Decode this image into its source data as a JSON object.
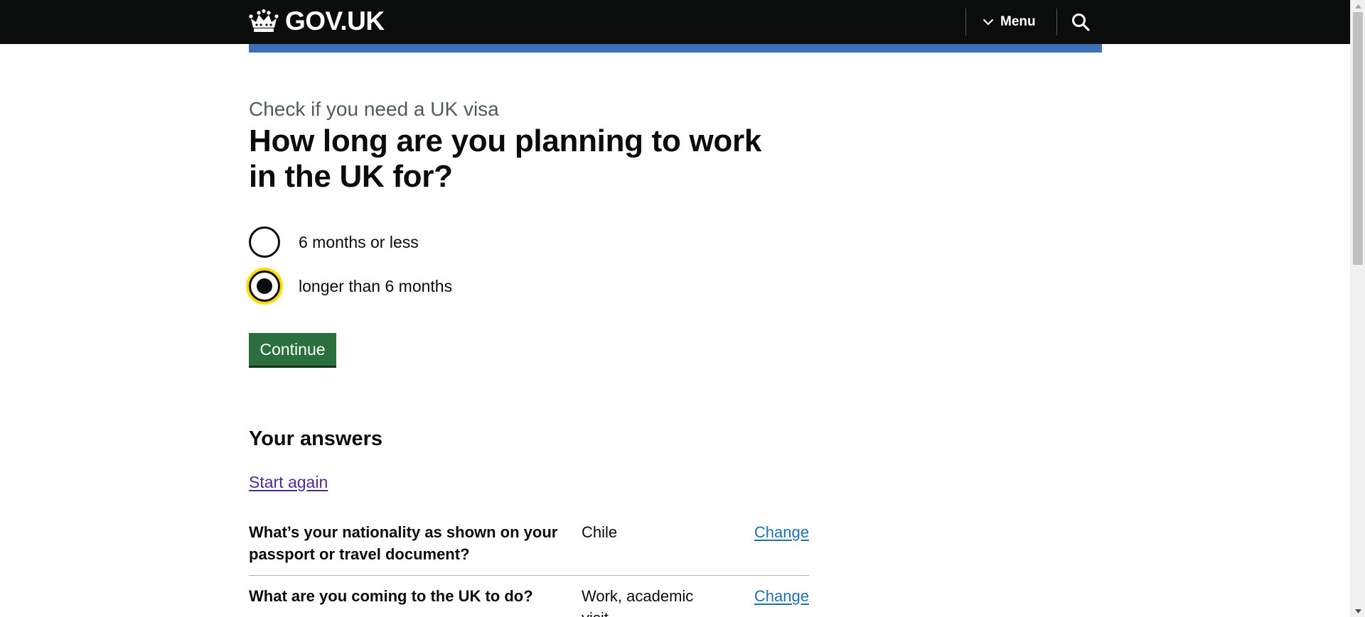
{
  "header": {
    "logo_text": "GOV.UK",
    "logo_icon": "crown-icon",
    "menu_label": "Menu",
    "menu_icon": "chevron-down-icon",
    "search_icon": "search-icon",
    "accent_color": "#3d72b8"
  },
  "main": {
    "caption": "Check if you need a UK visa",
    "heading": "How long are you planning to work in the UK for?",
    "options": [
      {
        "label": "6 months or less",
        "selected": false
      },
      {
        "label": "longer than 6 months",
        "selected": true
      }
    ],
    "continue_label": "Continue",
    "button_color": "#2b6f3c",
    "focus_color": "#ffdd00"
  },
  "answers": {
    "heading": "Your answers",
    "start_again": "Start again",
    "rows": [
      {
        "question": "What’s your nationality as shown on your passport or travel document?",
        "answer": "Chile",
        "change": "Change"
      },
      {
        "question": "What are you coming to the UK to do?",
        "answer": "Work, academic visit",
        "change": "Change"
      }
    ]
  }
}
